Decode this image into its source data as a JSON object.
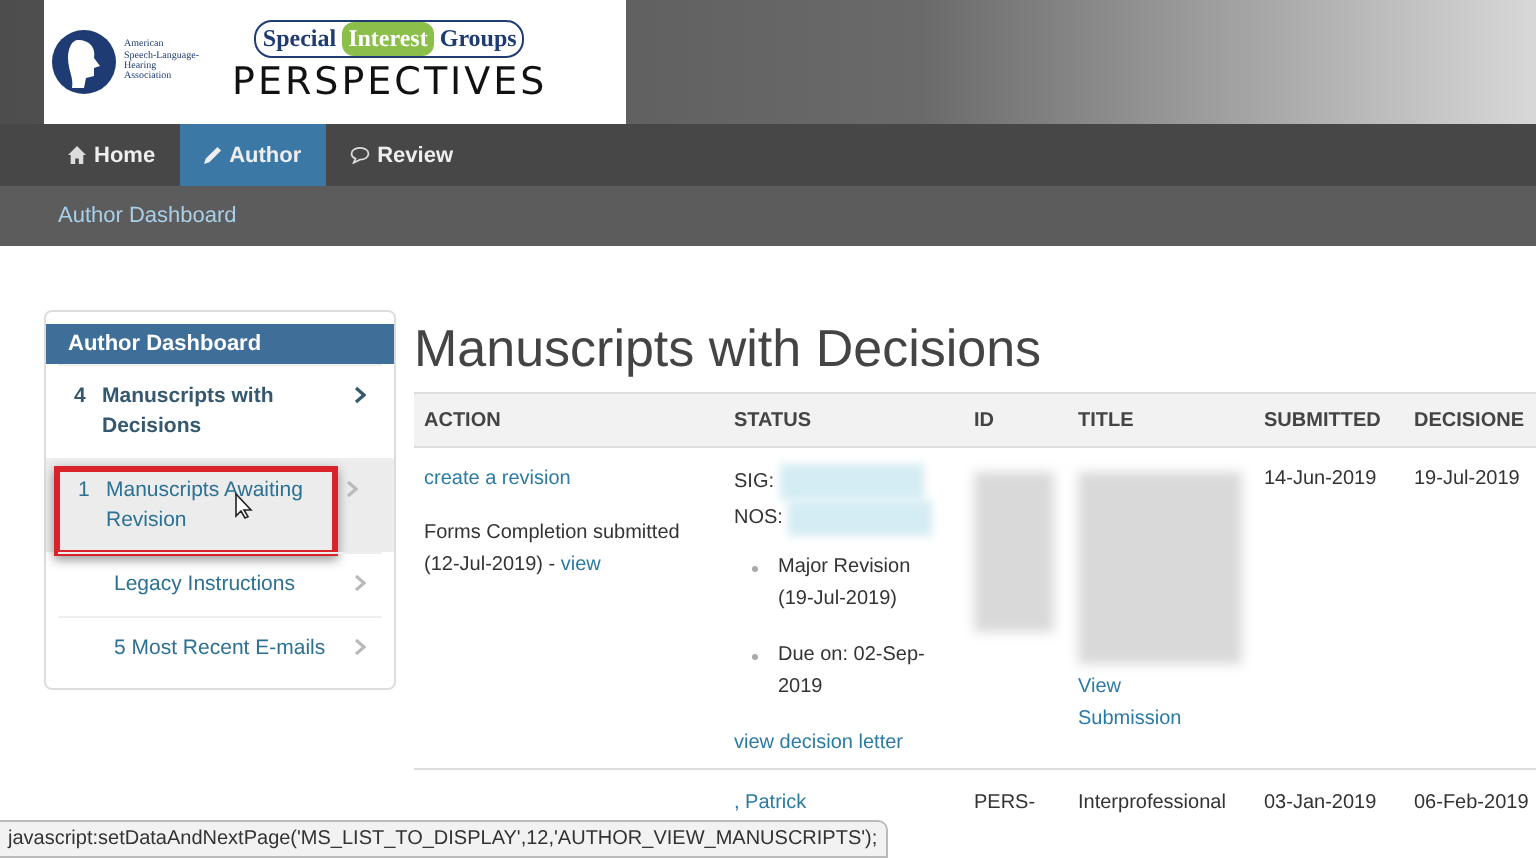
{
  "logo": {
    "org_lines": [
      "American",
      "Speech-Language-",
      "Hearing",
      "Association"
    ],
    "sig": [
      "Special",
      "Interest",
      "Groups"
    ],
    "title": "PERSPECTIVES"
  },
  "nav": [
    {
      "label": "Home",
      "selected": false
    },
    {
      "label": "Author",
      "selected": true
    },
    {
      "label": "Review",
      "selected": false
    }
  ],
  "breadcrumb": "Author Dashboard",
  "sidebar": {
    "title": "Author Dashboard",
    "items": [
      {
        "count": "4",
        "label": "Manuscripts with Decisions",
        "selected": true,
        "hovered": false
      },
      {
        "count": "1",
        "label": "Manuscripts Awaiting Revision",
        "selected": false,
        "hovered": true
      },
      {
        "label": "Legacy Instructions",
        "selected": false,
        "hovered": false
      },
      {
        "label": "5 Most Recent E-mails",
        "selected": false,
        "hovered": false
      }
    ]
  },
  "heading": "Manuscripts with Decisions",
  "table": {
    "columns": [
      "ACTION",
      "STATUS",
      "ID",
      "TITLE",
      "SUBMITTED",
      "DECISIONE"
    ],
    "rows": [
      {
        "kind": "detail",
        "action_link": "create a revision",
        "action_note": "Forms Completion submitted (12-Jul-2019) - ",
        "action_note_link": "view",
        "status_lines": [
          "SIG:",
          "NOS:"
        ],
        "status_bullets": [
          "Major Revision (19-Jul-2019)",
          "Due on: 02-Sep-2019"
        ],
        "status_link": "view decision letter",
        "title_link": "View Submission",
        "submitted": "14-Jun-2019",
        "decisioned": "19-Jul-2019"
      },
      {
        "kind": "summary",
        "author": ", Patrick",
        "id": "PERS-",
        "title": "Interprofessional",
        "submitted": "03-Jan-2019",
        "decisioned": "06-Feb-2019"
      }
    ]
  },
  "status_bar": "javascript:setDataAndNextPage('MS_LIST_TO_DISPLAY',12,'AUTHOR_VIEW_MANUSCRIPTS');"
}
